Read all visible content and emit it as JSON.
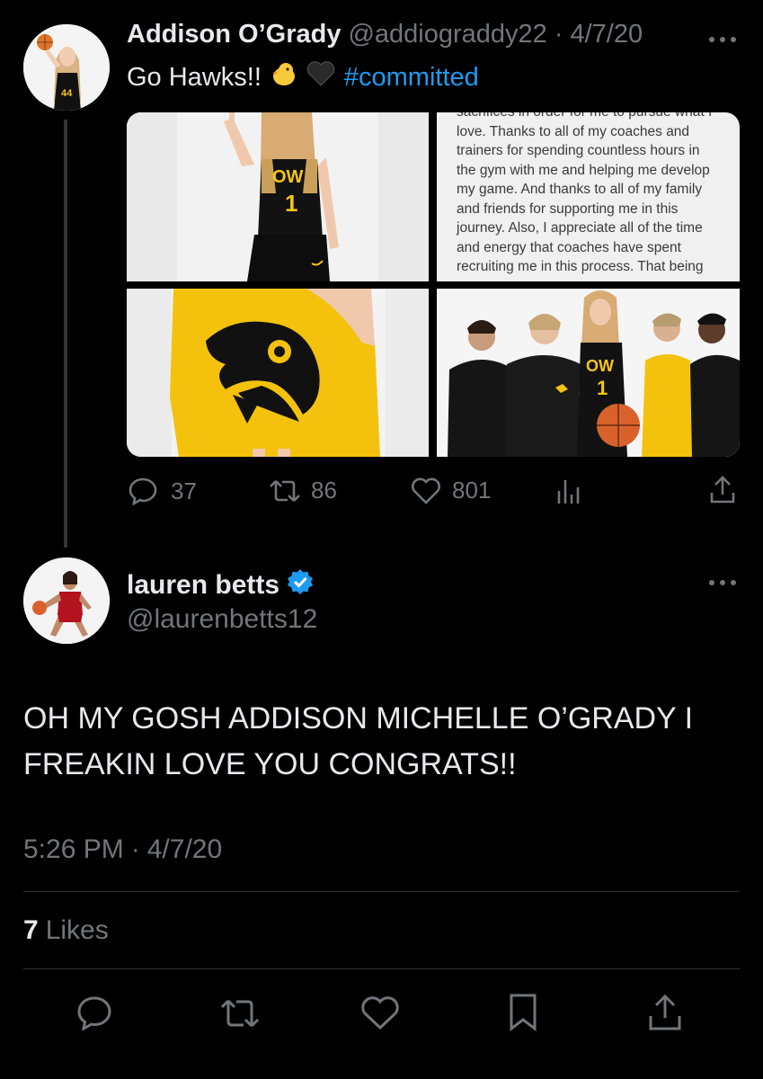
{
  "quoted_tweet": {
    "display_name": "Addison O’Grady",
    "handle": "@addiograddy22",
    "separator": "·",
    "date": "4/7/20",
    "text_prefix": "Go Hawks!!",
    "emojis": [
      "chick-emoji",
      "black-heart-emoji"
    ],
    "hashtag": "#committed",
    "images": [
      {
        "name": "player-pointing-photo",
        "jersey_text": "OW",
        "jersey_number": "1"
      },
      {
        "name": "commitment-letter-screenshot",
        "lines": [
          "sacrifices in order for me to pursue what I",
          "love. Thanks to all of my coaches and",
          "trainers for spending countless hours in",
          "the gym with me and helping me develop",
          "my game. And thanks to all of my family",
          "and friends for supporting me in this",
          "journey. Also, I appreciate all of the time",
          "and energy that coaches have spent",
          "recruiting me in this process. That being"
        ]
      },
      {
        "name": "hawkeye-flag-photo"
      },
      {
        "name": "coaches-group-photo",
        "jersey_text": "OW",
        "jersey_number": "1"
      }
    ],
    "actions": {
      "replies": "37",
      "retweets": "86",
      "likes": "801"
    },
    "avatar_jersey": "44"
  },
  "reply_tweet": {
    "display_name": "lauren betts",
    "verified": true,
    "handle": "@laurenbetts12",
    "text_line1": "OH MY GOSH ADDISON MICHELLE O’GRADY I",
    "text_line2": "FREAKIN LOVE YOU CONGRATS!!",
    "time": "5:26 PM",
    "separator": "·",
    "date": "4/7/20",
    "likes_count": "7",
    "likes_label": "Likes"
  },
  "colors": {
    "background": "#000000",
    "text": "#e7e9ea",
    "muted": "#71767b",
    "link": "#1d9bf0",
    "hawkeye_gold": "#f5c518",
    "verified_blue": "#1d9bf0"
  },
  "icons": [
    "more-icon",
    "reply-icon",
    "retweet-icon",
    "like-icon",
    "views-icon",
    "share-icon",
    "bookmark-icon",
    "verified-badge-icon"
  ]
}
